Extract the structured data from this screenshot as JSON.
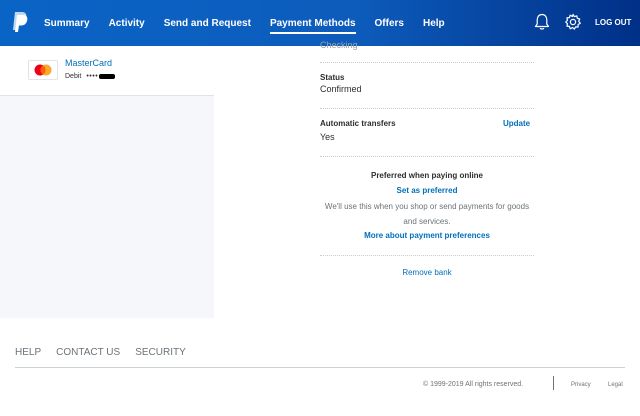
{
  "header": {
    "logo_icon": "paypal-logo-icon",
    "nav": [
      {
        "label": "Summary",
        "active": false
      },
      {
        "label": "Activity",
        "active": false
      },
      {
        "label": "Send and Request",
        "active": false
      },
      {
        "label": "Payment Methods",
        "active": true
      },
      {
        "label": "Offers",
        "active": false
      },
      {
        "label": "Help",
        "active": false
      }
    ],
    "notifications_icon": "bell-icon",
    "settings_icon": "gear-icon",
    "logout_label": "LOG OUT"
  },
  "sidebar": {
    "card": {
      "name": "MasterCard",
      "type": "Debit",
      "masked": "••••",
      "icon": "mastercard-logo-icon"
    }
  },
  "detail": {
    "cut_off_text": "Checking",
    "status_label": "Status",
    "status_value": "Confirmed",
    "auto_transfers_label": "Automatic transfers",
    "auto_transfers_value": "Yes",
    "update_link": "Update",
    "preferred_title": "Preferred when paying online",
    "set_preferred_link": "Set as preferred",
    "preferred_desc": "We'll use this when you shop or send payments for goods and services.",
    "more_link": "More about payment preferences",
    "remove_link": "Remove bank"
  },
  "footer": {
    "links": [
      "HELP",
      "CONTACT US",
      "SECURITY"
    ],
    "copyright": "© 1999-2019 All rights reserved.",
    "privacy": "Privacy",
    "legal": "Legal"
  },
  "colors": {
    "header_start": "#0a64c6",
    "header_end": "#003087",
    "link": "#0070ba",
    "sidebar_bg": "#f5f7fa"
  }
}
